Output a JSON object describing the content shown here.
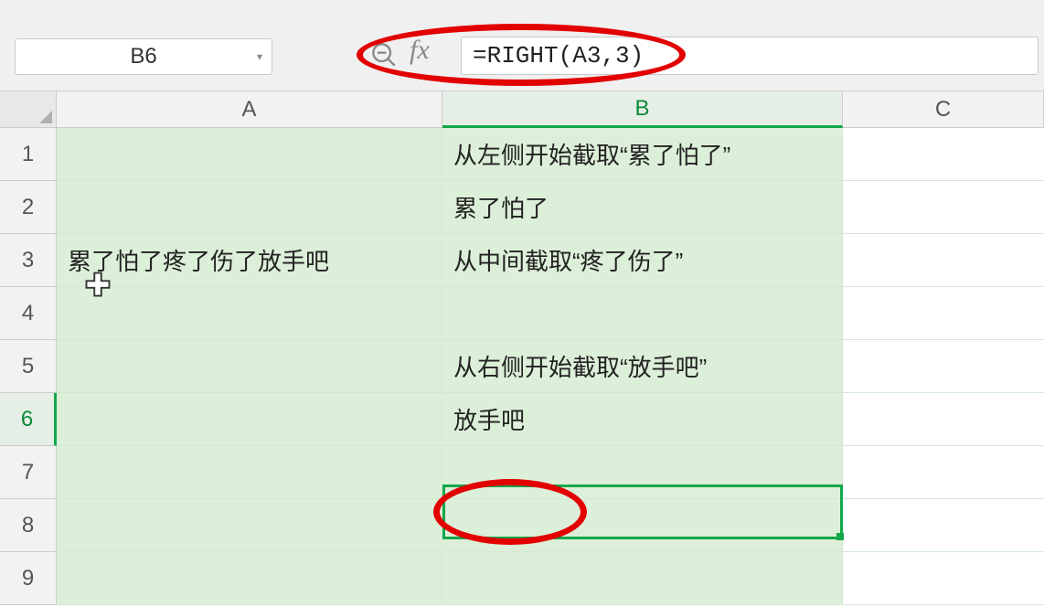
{
  "toolbar": {
    "cell_reference": "B6",
    "fx_label": "fx",
    "formula": "=RIGHT(A3,3)"
  },
  "columns": {
    "A": "A",
    "B": "B",
    "C": "C"
  },
  "row_headers": [
    "1",
    "2",
    "3",
    "4",
    "5",
    "6",
    "7",
    "8",
    "9"
  ],
  "cells": {
    "A3": "累了怕了疼了伤了放手吧",
    "B1": "从左侧开始截取“累了怕了”",
    "B2": "累了怕了",
    "B3": "从中间截取“疼了伤了”",
    "B5": "从右侧开始截取“放手吧”",
    "B6": "放手吧"
  },
  "active": {
    "column": "B",
    "row": "6"
  }
}
